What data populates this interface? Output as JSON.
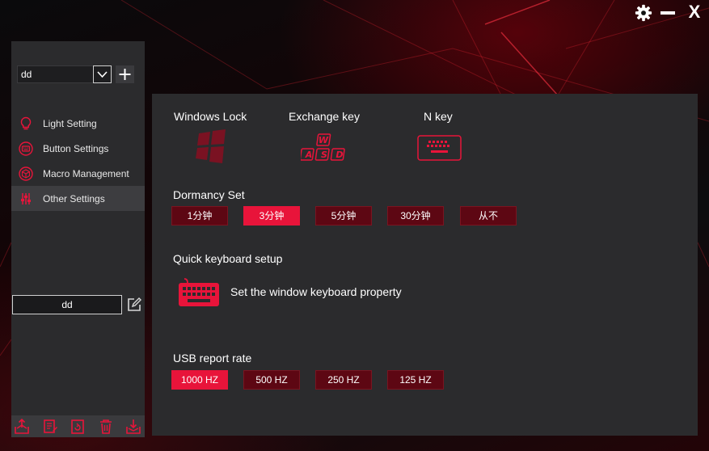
{
  "window": {
    "settings_icon": "gear-icon",
    "minimize_icon": "minimize-icon",
    "close_icon": "close-icon",
    "close_label": "X"
  },
  "sidebar": {
    "profile": {
      "selected": "dd",
      "dropdown_icon": "chevron-down-icon",
      "add_icon": "plus-icon"
    },
    "nav": [
      {
        "label": "Light Setting",
        "icon": "bulb-icon"
      },
      {
        "label": "Button Settings",
        "icon": "keyboard-icon"
      },
      {
        "label": "Macro Management",
        "icon": "cube-icon"
      },
      {
        "label": "Other Settings",
        "icon": "sliders-icon",
        "active": true
      }
    ],
    "profile_name": "dd",
    "edit_icon": "edit-icon",
    "footer_icons": [
      "export-icon",
      "notes-icon",
      "refresh-icon",
      "trash-icon",
      "import-icon"
    ]
  },
  "main": {
    "features": [
      {
        "label": "Windows Lock",
        "icon": "windows-logo-icon"
      },
      {
        "label": "Exchange key",
        "icon": "wasd-icon",
        "keys": [
          "W",
          "A",
          "S",
          "D"
        ]
      },
      {
        "label": "N key",
        "icon": "keyboard-icon"
      }
    ],
    "dormancy": {
      "title": "Dormancy Set",
      "options": [
        "1分钟",
        "3分钟",
        "5分钟",
        "30分钟",
        "从不"
      ],
      "selected": "3分钟"
    },
    "quick": {
      "title": "Quick keyboard setup",
      "text": "Set the window keyboard property",
      "icon": "keyboard-icon"
    },
    "usb": {
      "title": "USB report rate",
      "options": [
        "1000 HZ",
        "500 HZ",
        "250 HZ",
        "125 HZ"
      ],
      "selected": "1000 HZ"
    }
  },
  "colors": {
    "accent": "#e8143a",
    "option_bg": "#5d0713",
    "panel": "#2b2b2d"
  }
}
